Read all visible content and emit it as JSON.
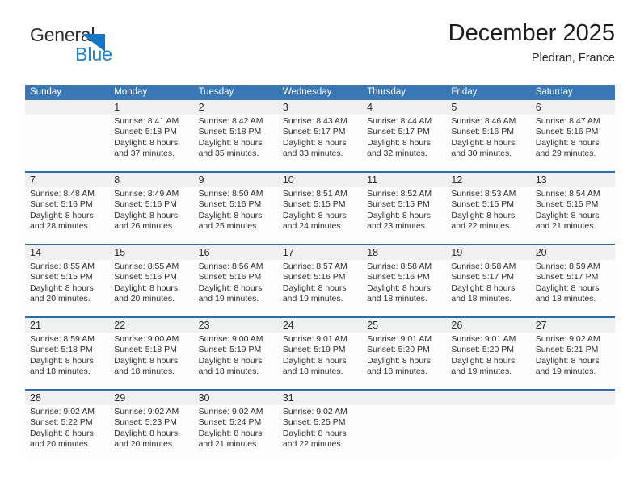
{
  "brand": {
    "name_part1": "General",
    "name_part2": "Blue",
    "triangle_color": "#1676c4",
    "blue_color": "#1b82d2"
  },
  "header": {
    "title": "December 2025",
    "subtitle": "Pledran, France"
  },
  "theme": {
    "header_bar": "#3a78b5",
    "week_separator": "#2a6ba8",
    "daynum_band": "#f0f0f0",
    "cell_background": "#fdfdfd"
  },
  "calendar": {
    "weekday_headers": [
      "Sunday",
      "Monday",
      "Tuesday",
      "Wednesday",
      "Thursday",
      "Friday",
      "Saturday"
    ],
    "weeks": [
      [
        {
          "day": "",
          "lines": []
        },
        {
          "day": "1",
          "lines": [
            "Sunrise: 8:41 AM",
            "Sunset: 5:18 PM",
            "Daylight: 8 hours",
            "and 37 minutes."
          ]
        },
        {
          "day": "2",
          "lines": [
            "Sunrise: 8:42 AM",
            "Sunset: 5:18 PM",
            "Daylight: 8 hours",
            "and 35 minutes."
          ]
        },
        {
          "day": "3",
          "lines": [
            "Sunrise: 8:43 AM",
            "Sunset: 5:17 PM",
            "Daylight: 8 hours",
            "and 33 minutes."
          ]
        },
        {
          "day": "4",
          "lines": [
            "Sunrise: 8:44 AM",
            "Sunset: 5:17 PM",
            "Daylight: 8 hours",
            "and 32 minutes."
          ]
        },
        {
          "day": "5",
          "lines": [
            "Sunrise: 8:46 AM",
            "Sunset: 5:16 PM",
            "Daylight: 8 hours",
            "and 30 minutes."
          ]
        },
        {
          "day": "6",
          "lines": [
            "Sunrise: 8:47 AM",
            "Sunset: 5:16 PM",
            "Daylight: 8 hours",
            "and 29 minutes."
          ]
        }
      ],
      [
        {
          "day": "7",
          "lines": [
            "Sunrise: 8:48 AM",
            "Sunset: 5:16 PM",
            "Daylight: 8 hours",
            "and 28 minutes."
          ]
        },
        {
          "day": "8",
          "lines": [
            "Sunrise: 8:49 AM",
            "Sunset: 5:16 PM",
            "Daylight: 8 hours",
            "and 26 minutes."
          ]
        },
        {
          "day": "9",
          "lines": [
            "Sunrise: 8:50 AM",
            "Sunset: 5:16 PM",
            "Daylight: 8 hours",
            "and 25 minutes."
          ]
        },
        {
          "day": "10",
          "lines": [
            "Sunrise: 8:51 AM",
            "Sunset: 5:15 PM",
            "Daylight: 8 hours",
            "and 24 minutes."
          ]
        },
        {
          "day": "11",
          "lines": [
            "Sunrise: 8:52 AM",
            "Sunset: 5:15 PM",
            "Daylight: 8 hours",
            "and 23 minutes."
          ]
        },
        {
          "day": "12",
          "lines": [
            "Sunrise: 8:53 AM",
            "Sunset: 5:15 PM",
            "Daylight: 8 hours",
            "and 22 minutes."
          ]
        },
        {
          "day": "13",
          "lines": [
            "Sunrise: 8:54 AM",
            "Sunset: 5:15 PM",
            "Daylight: 8 hours",
            "and 21 minutes."
          ]
        }
      ],
      [
        {
          "day": "14",
          "lines": [
            "Sunrise: 8:55 AM",
            "Sunset: 5:15 PM",
            "Daylight: 8 hours",
            "and 20 minutes."
          ]
        },
        {
          "day": "15",
          "lines": [
            "Sunrise: 8:55 AM",
            "Sunset: 5:16 PM",
            "Daylight: 8 hours",
            "and 20 minutes."
          ]
        },
        {
          "day": "16",
          "lines": [
            "Sunrise: 8:56 AM",
            "Sunset: 5:16 PM",
            "Daylight: 8 hours",
            "and 19 minutes."
          ]
        },
        {
          "day": "17",
          "lines": [
            "Sunrise: 8:57 AM",
            "Sunset: 5:16 PM",
            "Daylight: 8 hours",
            "and 19 minutes."
          ]
        },
        {
          "day": "18",
          "lines": [
            "Sunrise: 8:58 AM",
            "Sunset: 5:16 PM",
            "Daylight: 8 hours",
            "and 18 minutes."
          ]
        },
        {
          "day": "19",
          "lines": [
            "Sunrise: 8:58 AM",
            "Sunset: 5:17 PM",
            "Daylight: 8 hours",
            "and 18 minutes."
          ]
        },
        {
          "day": "20",
          "lines": [
            "Sunrise: 8:59 AM",
            "Sunset: 5:17 PM",
            "Daylight: 8 hours",
            "and 18 minutes."
          ]
        }
      ],
      [
        {
          "day": "21",
          "lines": [
            "Sunrise: 8:59 AM",
            "Sunset: 5:18 PM",
            "Daylight: 8 hours",
            "and 18 minutes."
          ]
        },
        {
          "day": "22",
          "lines": [
            "Sunrise: 9:00 AM",
            "Sunset: 5:18 PM",
            "Daylight: 8 hours",
            "and 18 minutes."
          ]
        },
        {
          "day": "23",
          "lines": [
            "Sunrise: 9:00 AM",
            "Sunset: 5:19 PM",
            "Daylight: 8 hours",
            "and 18 minutes."
          ]
        },
        {
          "day": "24",
          "lines": [
            "Sunrise: 9:01 AM",
            "Sunset: 5:19 PM",
            "Daylight: 8 hours",
            "and 18 minutes."
          ]
        },
        {
          "day": "25",
          "lines": [
            "Sunrise: 9:01 AM",
            "Sunset: 5:20 PM",
            "Daylight: 8 hours",
            "and 18 minutes."
          ]
        },
        {
          "day": "26",
          "lines": [
            "Sunrise: 9:01 AM",
            "Sunset: 5:20 PM",
            "Daylight: 8 hours",
            "and 19 minutes."
          ]
        },
        {
          "day": "27",
          "lines": [
            "Sunrise: 9:02 AM",
            "Sunset: 5:21 PM",
            "Daylight: 8 hours",
            "and 19 minutes."
          ]
        }
      ],
      [
        {
          "day": "28",
          "lines": [
            "Sunrise: 9:02 AM",
            "Sunset: 5:22 PM",
            "Daylight: 8 hours",
            "and 20 minutes."
          ]
        },
        {
          "day": "29",
          "lines": [
            "Sunrise: 9:02 AM",
            "Sunset: 5:23 PM",
            "Daylight: 8 hours",
            "and 20 minutes."
          ]
        },
        {
          "day": "30",
          "lines": [
            "Sunrise: 9:02 AM",
            "Sunset: 5:24 PM",
            "Daylight: 8 hours",
            "and 21 minutes."
          ]
        },
        {
          "day": "31",
          "lines": [
            "Sunrise: 9:02 AM",
            "Sunset: 5:25 PM",
            "Daylight: 8 hours",
            "and 22 minutes."
          ]
        },
        {
          "day": "",
          "lines": []
        },
        {
          "day": "",
          "lines": []
        },
        {
          "day": "",
          "lines": []
        }
      ]
    ]
  }
}
